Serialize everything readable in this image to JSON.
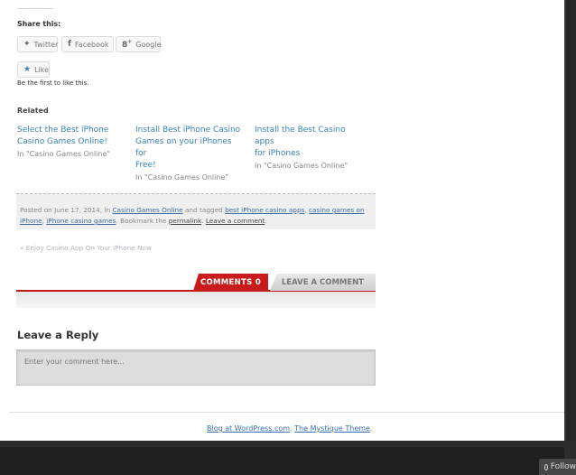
{
  "share": {
    "title": "Share this:",
    "buttons": [
      {
        "label": "Twitter",
        "icon": "twitter-icon"
      },
      {
        "label": "Facebook",
        "icon": "facebook-icon"
      },
      {
        "label": "Google",
        "icon": "google-plus-icon"
      }
    ],
    "like_label": "Like",
    "like_note": "Be the first to like this."
  },
  "related": {
    "title": "Related",
    "items": [
      {
        "title_line1": "Select the Best iPhone",
        "title_line2": "Casino Games Online!",
        "title_line3": "",
        "category": "In \"Casino Games Online\""
      },
      {
        "title_line1": "Install Best iPhone Casino",
        "title_line2": "Games on your iPhones for",
        "title_line3": "Free!",
        "category": "In \"Casino Games Online\""
      },
      {
        "title_line1": "Install the Best Casino apps",
        "title_line2": "for iPhones",
        "title_line3": "",
        "category": "In \"Casino Games Online\""
      }
    ]
  },
  "meta": {
    "posted_on": "Posted on June 17, 2014, in",
    "category": "Casino Games Online",
    "tagged_text": "and tagged",
    "tag1": "best iPhone casino apps",
    "tag2": "casino games on iPhone",
    "tag3": "iPhone casino games",
    "bookmark_text": "Bookmark the",
    "permalink": "permalink",
    "comment_link": "Leave a comment"
  },
  "prev_post": "Enjoy Casino App On Your iPhone Now",
  "tabs": {
    "comments": "COMMENTS 0",
    "leave": "LEAVE A COMMENT"
  },
  "reply": {
    "title": "Leave a Reply",
    "placeholder": "Enter your comment here..."
  },
  "footer": {
    "blog_link": "Blog at WordPress.com",
    "theme_link": "The Mystique Theme"
  },
  "follow_label": "Follow",
  "colors": {
    "accent_red": "#c81b1b",
    "link_blue": "#3a82b6"
  }
}
